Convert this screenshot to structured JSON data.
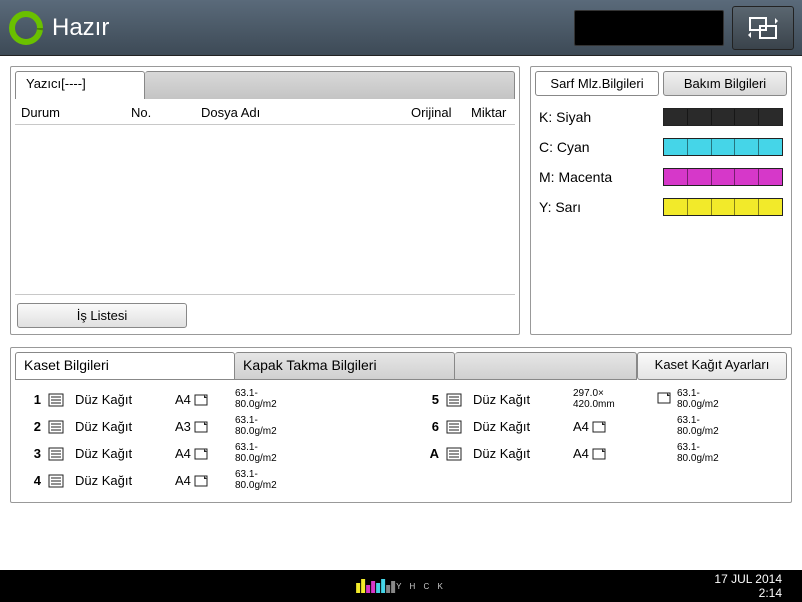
{
  "header": {
    "status_title": "Hazır"
  },
  "job_panel": {
    "tab_label": "Yazıcı[----]",
    "columns": {
      "c1": "Durum",
      "c2": "No.",
      "c3": "Dosya Adı",
      "c4": "Orijinal",
      "c5": "Miktar"
    },
    "job_list_button": "İş Listesi"
  },
  "supplies": {
    "tab1": "Sarf Mlz.Bilgileri",
    "tab2": "Bakım Bilgileri",
    "toners": [
      {
        "label": "K: Siyah",
        "color": "#2a2a2a"
      },
      {
        "label": "C: Cyan",
        "color": "#45d5e8"
      },
      {
        "label": "M: Macenta",
        "color": "#d638c9"
      },
      {
        "label": "Y: Sarı",
        "color": "#f2ea2a"
      }
    ]
  },
  "cassette": {
    "tab1": "Kaset Bilgileri",
    "tab2": "Kapak Takma Bilgileri",
    "settings_btn": "Kaset Kağıt Ayarları",
    "trays_left": [
      {
        "num": "1",
        "type": "Düz Kağıt",
        "size": "A4",
        "wt1": "63.1-",
        "wt2": "80.0g/m2"
      },
      {
        "num": "2",
        "type": "Düz Kağıt",
        "size": "A3",
        "wt1": "63.1-",
        "wt2": "80.0g/m2"
      },
      {
        "num": "3",
        "type": "Düz Kağıt",
        "size": "A4",
        "wt1": "63.1-",
        "wt2": "80.0g/m2"
      },
      {
        "num": "4",
        "type": "Düz Kağıt",
        "size": "A4",
        "wt1": "63.1-",
        "wt2": "80.0g/m2"
      }
    ],
    "trays_right": [
      {
        "num": "5",
        "type": "Düz Kağıt",
        "size": "",
        "dim1": "297.0×",
        "dim2": "420.0mm",
        "wt1": "63.1-",
        "wt2": "80.0g/m2"
      },
      {
        "num": "6",
        "type": "Düz Kağıt",
        "size": "A4",
        "wt1": "63.1-",
        "wt2": "80.0g/m2"
      },
      {
        "num": "A",
        "type": "Düz Kağıt",
        "size": "A4",
        "wt1": "63.1-",
        "wt2": "80.0g/m2"
      }
    ]
  },
  "footer": {
    "date": "17 JUL  2014",
    "time": "2:14",
    "ymck_label": "Y H C K"
  }
}
